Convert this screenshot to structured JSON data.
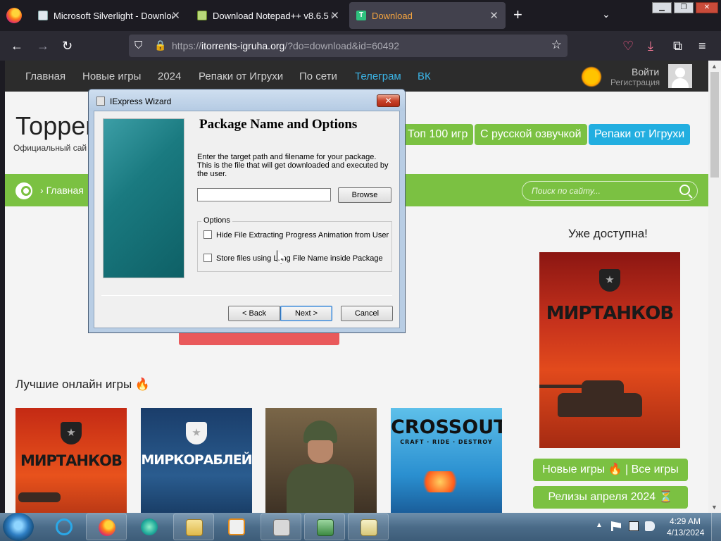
{
  "browser": {
    "tabs": [
      {
        "title": "Microsoft Silverlight - Downloa",
        "favicon": "silverlight-favicon-icon",
        "close": "✕"
      },
      {
        "title": "Download Notepad++ v8.6.5 (s",
        "favicon": "notepad-favicon-icon",
        "close": "✕"
      },
      {
        "title": "Download",
        "favicon": "site-favicon-icon",
        "close": "✕"
      }
    ],
    "new_tab": "+",
    "tab_list": "⌄",
    "window_buttons": [
      "▁",
      "❐",
      "✕"
    ],
    "url_scheme": "https://",
    "url_host": "itorrents-igruha.org",
    "url_path": "/?do=download&id=60492",
    "nav_icons": {
      "back": "←",
      "forward": "→",
      "reload": "↻",
      "star": "☆",
      "pocket": "♡",
      "download": "⤓",
      "extensions": "⧉",
      "menu": "≡",
      "shield": "⛉",
      "lock": "🔒"
    }
  },
  "site": {
    "nav": [
      "Главная",
      "Новые игры",
      "2024",
      "Репаки от Игрухи",
      "По сети",
      "Телеграм",
      "ВК"
    ],
    "nav_accent": "#3bb4e6",
    "login": "Войти",
    "register": "Регистрация",
    "title": "Торрен",
    "subtitle": "Официальный сай",
    "pills": [
      "Топ 100 игр",
      "С русской озвучкой",
      "Репаки от Игрухи"
    ],
    "pill_colors": [
      "#7bc142",
      "#7bc142",
      "#22aee0"
    ],
    "breadcrumb_home": "Главная",
    "search_placeholder": "Поиск по сайту...",
    "available_title": "Уже доступна!",
    "promo_logo": "МИРТАНКОВ",
    "best_title": "Лучшие онлайн игры 🔥",
    "games": [
      "МИРТАНКОВ",
      "МИРКОРАБЛЕЙ",
      "",
      "CROSSOUT"
    ],
    "crossout_tagline": "CRAFT · RIDE · DESTROY",
    "green_buttons": [
      "Новые игры 🔥 | Все игры",
      "Релизы апреля 2024 ⏳"
    ],
    "green": "#7bc142"
  },
  "dialog": {
    "title": "IExpress Wizard",
    "close": "✕",
    "heading": "Package Name and Options",
    "description": "Enter the target path and filename for your package. This is the file that will get downloaded and executed by the user.",
    "path_value": "",
    "browse": "Browse",
    "options_label": "Options",
    "options": [
      {
        "label": "Hide File Extracting Progress Animation from User",
        "checked": false
      },
      {
        "label": "Store files using Long File Name inside Package",
        "checked": false
      }
    ],
    "back": "< Back",
    "next": "Next >",
    "cancel": "Cancel"
  },
  "taskbar": {
    "time": "4:29 AM",
    "date": "4/13/2024"
  }
}
